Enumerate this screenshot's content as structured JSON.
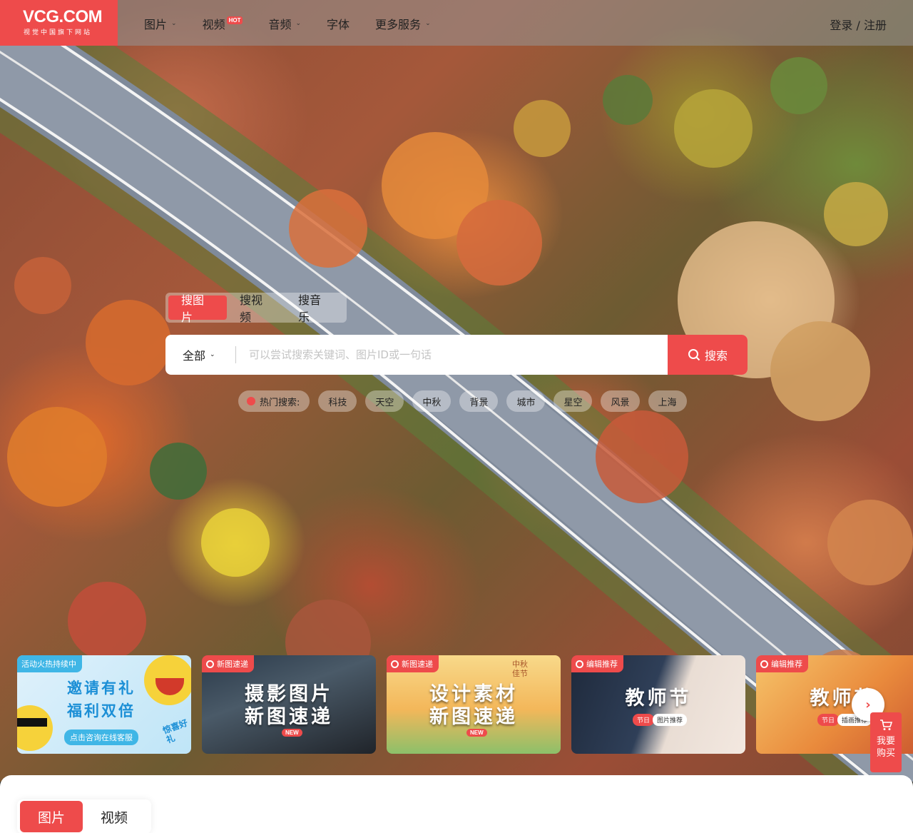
{
  "brand": {
    "name": "VCG.COM",
    "tagline": "视觉中国旗下网站"
  },
  "nav": {
    "items": [
      {
        "label": "图片",
        "has_dropdown": true
      },
      {
        "label": "视频",
        "badge": "HOT"
      },
      {
        "label": "音频",
        "has_dropdown": true
      },
      {
        "label": "字体"
      },
      {
        "label": "更多服务",
        "has_dropdown": true
      }
    ],
    "login": "登录 / 注册"
  },
  "search": {
    "tabs": [
      "搜图片",
      "搜视频",
      "搜音乐"
    ],
    "active_tab": "搜图片",
    "scope": "全部",
    "placeholder": "可以尝试搜索关键词、图片ID或一句话",
    "button": "搜索",
    "hot_label": "热门搜索:",
    "hot_terms": [
      "科技",
      "天空",
      "中秋",
      "背景",
      "城市",
      "星空",
      "风景",
      "上海"
    ]
  },
  "banners": [
    {
      "tag": "活动火热持续中",
      "lines": [
        "邀请有礼",
        "福利双倍"
      ],
      "cta": "点击咨询在线客服",
      "side": "惊喜好礼"
    },
    {
      "tag": "新图速递",
      "lines": [
        "摄影图片",
        "新图速递"
      ],
      "badge": "NEW"
    },
    {
      "tag": "新图速递",
      "lines": [
        "设计素材",
        "新图速递"
      ],
      "badge": "NEW",
      "corner": "中秋佳节"
    },
    {
      "tag": "编辑推荐",
      "lines": [
        "教师节"
      ],
      "chips": [
        "节日",
        "图片推荐"
      ]
    },
    {
      "tag": "编辑推荐",
      "lines": [
        "教师节"
      ],
      "chips": [
        "节日",
        "插画推荐"
      ]
    }
  ],
  "buy": {
    "label_1": "我要",
    "label_2": "购买"
  },
  "content_tabs": [
    "图片",
    "视频"
  ],
  "colors": {
    "accent": "#ee4b4b"
  },
  "icons": [
    "chevron-down-icon",
    "camera-icon",
    "search-icon",
    "flame-icon",
    "chevron-right-icon",
    "cart-icon"
  ]
}
